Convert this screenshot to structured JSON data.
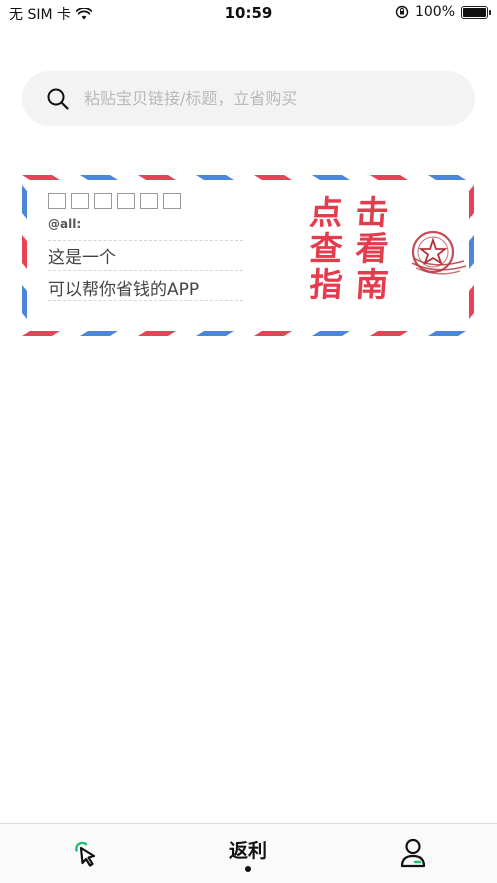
{
  "status_bar": {
    "carrier": "无 SIM 卡",
    "time": "10:59",
    "battery_percent": "100%",
    "battery_level": 1.0
  },
  "search": {
    "placeholder": "粘贴宝贝链接/标题，立省购买",
    "value": ""
  },
  "envelope": {
    "greeting": "@all:",
    "line1": "这是一个",
    "line2": "可以帮你省钱的APP",
    "guide_chars": [
      "点",
      "击",
      "查",
      "看",
      "指",
      "南"
    ],
    "stripe_colors": [
      "#e84256",
      "#4a86d9"
    ],
    "guide_color": "#e43b4d"
  },
  "tabbar": {
    "tabs": [
      {
        "label": "",
        "icon": "cursor-click-icon",
        "selected": false
      },
      {
        "label": "返利",
        "icon": "",
        "selected": true
      },
      {
        "label": "",
        "icon": "user-icon",
        "selected": false
      }
    ],
    "accent": "#1fbe70"
  }
}
